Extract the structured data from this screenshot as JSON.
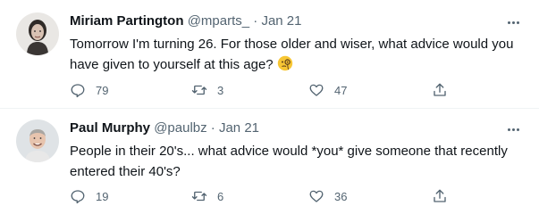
{
  "tweets": [
    {
      "name": "Miriam Partington",
      "handle": "@mparts_",
      "separator": "·",
      "date": "Jan 21",
      "lines": [
        "Tomorrow I'm turning 26. For those older and wiser, what advice would you",
        "have given to yourself at this age?"
      ],
      "emoji": "face-with-monocle",
      "replies": "79",
      "retweets": "3",
      "likes": "47"
    },
    {
      "name": "Paul Murphy",
      "handle": "@paulbz",
      "separator": "·",
      "date": "Jan 21",
      "lines": [
        "People in their 20's... what advice would *you* give someone that recently",
        "entered their 40's?"
      ],
      "replies": "19",
      "retweets": "6",
      "likes": "36"
    }
  ],
  "colors": {
    "text_primary": "#0f1419",
    "text_secondary": "#536471",
    "divider": "#eff3f4",
    "emoji_yellow": "#f7c634"
  }
}
